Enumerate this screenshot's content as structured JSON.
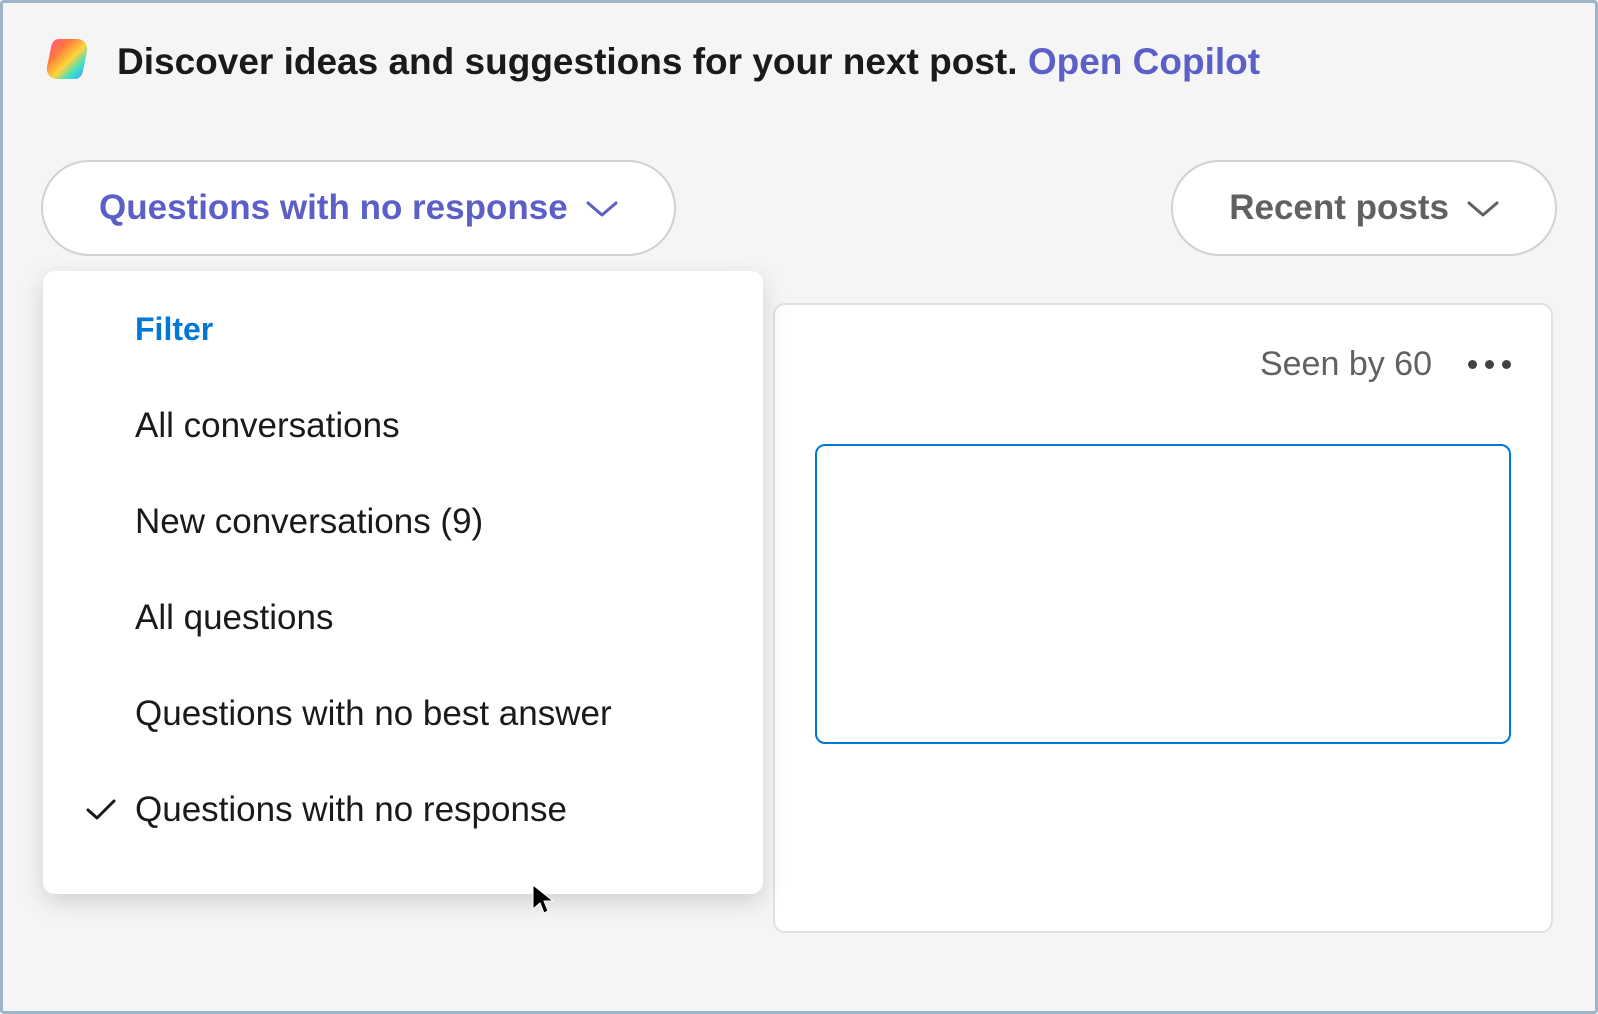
{
  "banner": {
    "prompt_text": "Discover ideas and suggestions for your next post. ",
    "link_text": "Open Copilot"
  },
  "filters": {
    "primary_label": "Questions with no response",
    "secondary_label": "Recent posts"
  },
  "dropdown": {
    "header": "Filter",
    "items": [
      {
        "label": "All conversations",
        "selected": false
      },
      {
        "label": "New conversations (9)",
        "selected": false
      },
      {
        "label": "All questions",
        "selected": false
      },
      {
        "label": "Questions with no best answer",
        "selected": false
      },
      {
        "label": "Questions with no response",
        "selected": true
      }
    ]
  },
  "post": {
    "seen_by_label": "Seen by 60"
  }
}
